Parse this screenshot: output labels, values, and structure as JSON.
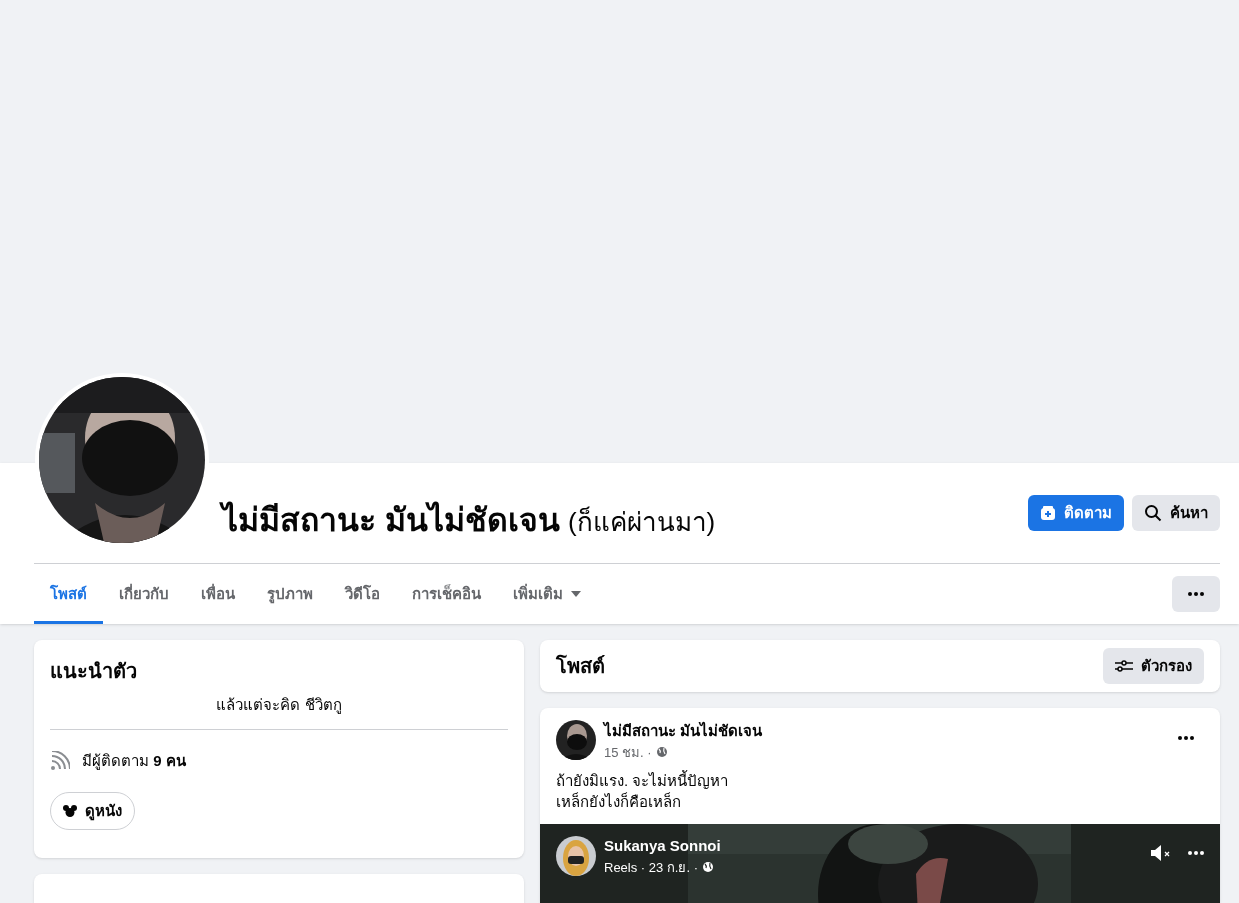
{
  "profile": {
    "name": "ไม่มีสถานะ มันไม่ชัดเจน",
    "alt_name": "(ก็แค่ผ่านมา)",
    "buttons": [
      {
        "kind": "primary",
        "label": "ติดตาม"
      },
      {
        "kind": "search",
        "label": "ค้นหา"
      }
    ]
  },
  "tabs": [
    {
      "label": "โพสต์",
      "selected": true
    },
    {
      "label": "เกี่ยวกับ",
      "selected": false
    },
    {
      "label": "เพื่อน",
      "selected": false
    },
    {
      "label": "รูปภาพ",
      "selected": false
    },
    {
      "label": "วิดีโอ",
      "selected": false
    },
    {
      "label": "การเช็คอิน",
      "selected": false
    },
    {
      "label": "เพิ่มเติม",
      "selected": false,
      "dropdown": true
    }
  ],
  "intro": {
    "title": "แนะนำตัว",
    "bio": "แล้วแต่จะคิด ชีวิตกู",
    "followers": "มีผู้ติดตาม **9 คน**",
    "hobby": "ดูหนัง"
  },
  "posts_header": {
    "title": "โพสต์",
    "filter": "ตัวกรอง"
  },
  "post": {
    "author": "ไม่มีสถานะ มันไม่ชัดเจน",
    "time": "15 ชม. ·",
    "lines": [
      "ถ้ายังมิแรง. จะไม่หนี้ปัญหา",
      "เหล็กยังไงก็คือเหล็ก"
    ],
    "shared": {
      "author": "Sukanya Sonnoi",
      "meta": "Reels · 23 ก.ย. ·"
    }
  }
}
